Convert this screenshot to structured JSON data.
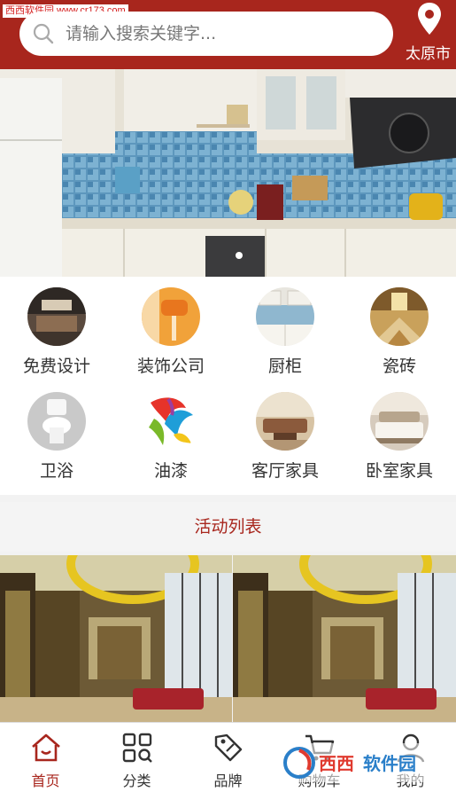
{
  "watermark": "西西软件园 www.cr173.com",
  "search": {
    "placeholder": "请输入搜索关键字..."
  },
  "location": {
    "city": "太原市"
  },
  "banner": {
    "indicator_dots": 1
  },
  "categories": [
    {
      "label": "免费设计",
      "icon": "free-design-photo"
    },
    {
      "label": "装饰公司",
      "icon": "paint-roller-photo"
    },
    {
      "label": "厨柜",
      "icon": "kitchen-cabinet-photo"
    },
    {
      "label": "瓷砖",
      "icon": "tile-photo"
    },
    {
      "label": "卫浴",
      "icon": "toilet-photo"
    },
    {
      "label": "油漆",
      "icon": "paint-splash-photo"
    },
    {
      "label": "客厅家具",
      "icon": "living-room-photo"
    },
    {
      "label": "卧室家具",
      "icon": "bedroom-photo"
    }
  ],
  "activity": {
    "title": "活动列表"
  },
  "tabs": [
    {
      "label": "首页",
      "icon": "home-icon",
      "active": true
    },
    {
      "label": "分类",
      "icon": "category-grid-icon",
      "active": false
    },
    {
      "label": "品牌",
      "icon": "brand-tag-icon",
      "active": false
    },
    {
      "label": "购物车",
      "icon": "cart-icon",
      "active": false
    },
    {
      "label": "我的",
      "icon": "user-icon",
      "active": false
    }
  ],
  "corner_watermark": {
    "brand": "西西",
    "label": "软件园"
  },
  "colors": {
    "brand_red": "#a8261d",
    "text": "#333333",
    "placeholder": "#777777"
  }
}
